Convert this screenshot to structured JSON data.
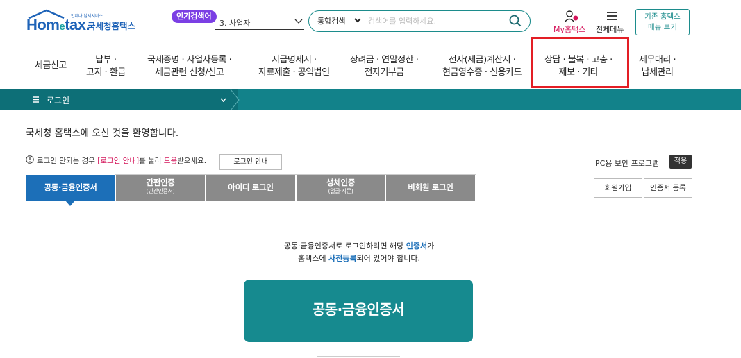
{
  "header": {
    "logo_text_home": "Hom",
    "logo_text_e": "e",
    "logo_text_tax": "tax.",
    "logo_tagline": "언제나 납세서비스",
    "logo_name": "국세청홈택스",
    "popular_badge": "인기검색어",
    "popular_item": "3.  사업자",
    "search_scope": "통합검색",
    "search_placeholder": "검색어를 입력하세요.",
    "my_hometax": "My홈택스",
    "all_menu": "전체메뉴",
    "old_home_line1": "기존 홈택스",
    "old_home_line2": "메뉴 보기"
  },
  "gnb": [
    {
      "line1": "세금신고",
      "line2": ""
    },
    {
      "line1": "납부 ·",
      "line2": "고지 · 환급"
    },
    {
      "line1": "국세증명 · 사업자등록 ·",
      "line2": "세금관련 신청/신고"
    },
    {
      "line1": "지급명세서 ·",
      "line2": "자료제출 · 공익법인"
    },
    {
      "line1": "장려금 · 연말정산 ·",
      "line2": "전자기부금"
    },
    {
      "line1": "전자(세금)계산서 ·",
      "line2": "현금영수증 · 신용카드"
    },
    {
      "line1": "상담 · 불복 · 고충 ·",
      "line2": "제보 · 기타"
    },
    {
      "line1": "세무대리 ·",
      "line2": "납세관리"
    }
  ],
  "login_bar": {
    "label": "로그인"
  },
  "content": {
    "welcome": "국세청 홈택스에 오신 것을 환영합니다.",
    "notice_prefix": "로그인 안되는 경우 ",
    "notice_link": "[로그인 안내]",
    "notice_mid": "를 눌러 ",
    "notice_help": "도움",
    "notice_suffix": "받으세요.",
    "login_guide_button": "로그인 안내",
    "pc_security_label": "PC용 보안 프로그램",
    "pc_security_apply": "적용",
    "register_button": "회원가입",
    "cert_register_button": "인증서 등록",
    "guide_line1_a": "공동·금융인증서로 로그인하려면 해당 ",
    "guide_line1_b": "인증서",
    "guide_line1_c": "가",
    "guide_line2_a": "홈택스에 ",
    "guide_line2_b": "사전등록",
    "guide_line2_c": "되어 있어야 합니다.",
    "cert_login_button": "공동·금융인증서"
  },
  "tabs": [
    {
      "label": "공동·금융인증서",
      "sub": "",
      "active": true
    },
    {
      "label": "간편인증",
      "sub": "(민간인증서)",
      "active": false
    },
    {
      "label": "아이디 로그인",
      "sub": "",
      "active": false
    },
    {
      "label": "생체인증",
      "sub": "(얼굴·지문)",
      "active": false
    },
    {
      "label": "비회원 로그인",
      "sub": "",
      "active": false
    }
  ],
  "colors": {
    "brand_blue": "#1e63b8",
    "teal": "#12828a",
    "active_tab": "#1c6fb8",
    "highlight_red": "#e31e25",
    "cert_button": "#168a8f"
  }
}
